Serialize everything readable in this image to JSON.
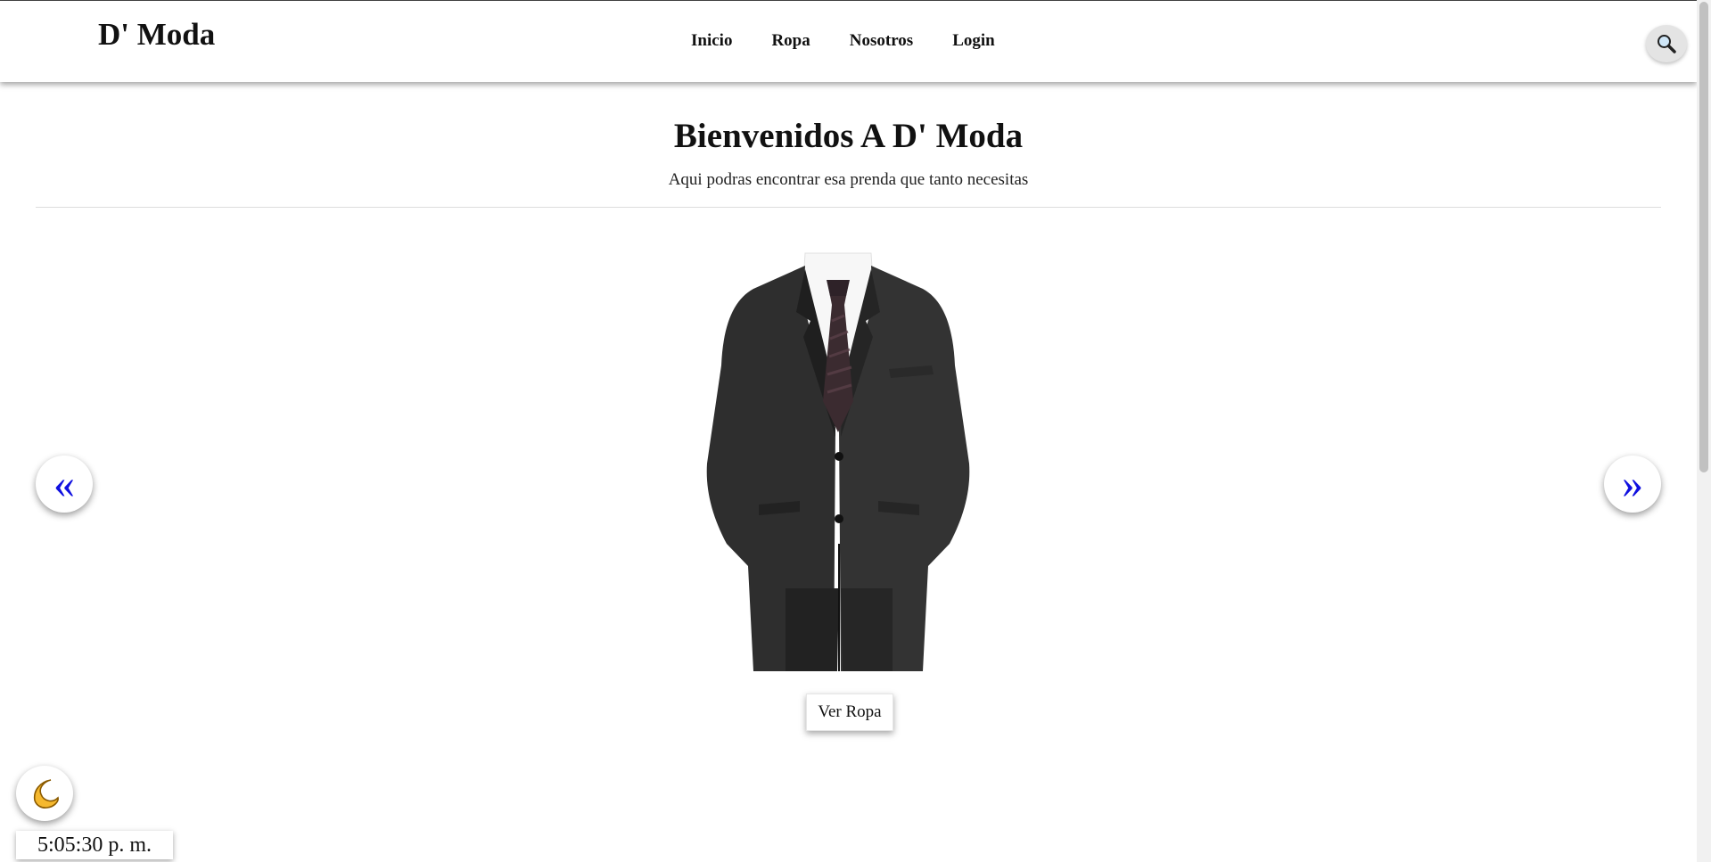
{
  "brand": "D' Moda",
  "nav": [
    {
      "label": "Inicio"
    },
    {
      "label": "Ropa"
    },
    {
      "label": "Nosotros"
    },
    {
      "label": "Login"
    }
  ],
  "hero": {
    "title": "Bienvenidos A D' Moda",
    "subtitle": "Aqui podras encontrar esa prenda que tanto necesitas"
  },
  "carousel": {
    "prev_label": "«",
    "next_label": "»",
    "cta_label": "Ver Ropa"
  },
  "clock": "5:05:30 p. m.",
  "icons": {
    "search": "search-icon",
    "theme": "moon-icon"
  },
  "colors": {
    "arrow": "#1010e0",
    "moon": "#f5b82e"
  }
}
